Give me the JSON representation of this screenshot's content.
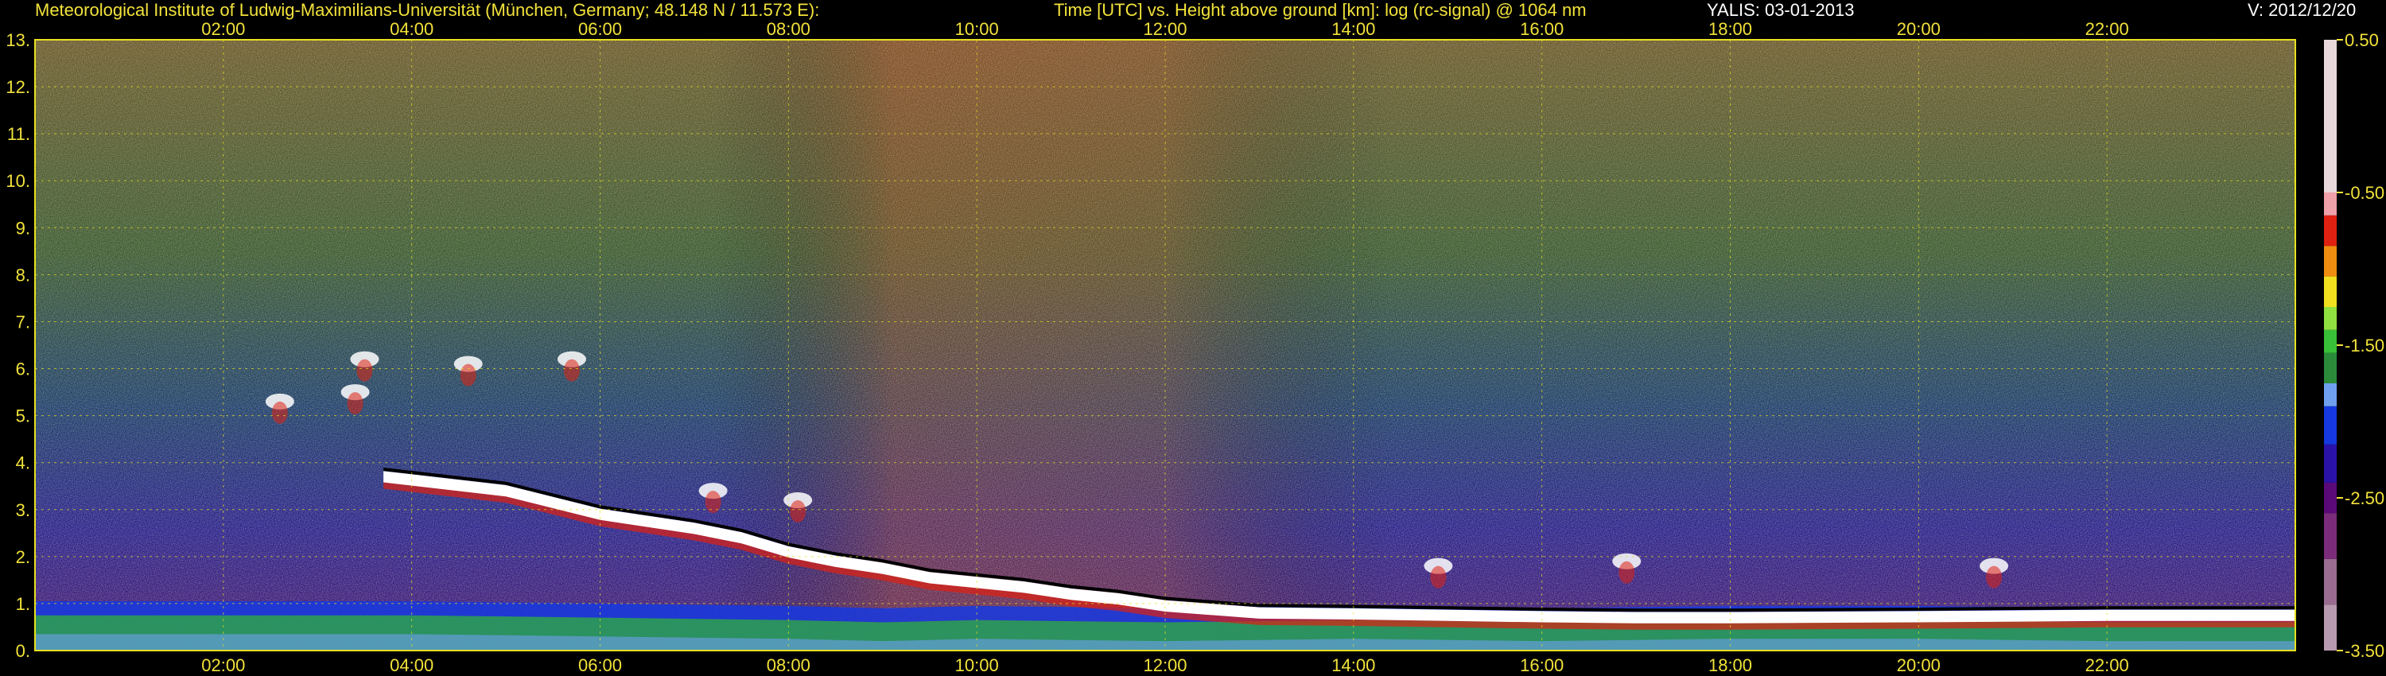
{
  "header": {
    "institute": "Meteorological Institute of Ludwig-Maximilians-Universität (München, Germany; 48.148 N / 11.573 E):",
    "description": "Time [UTC] vs. Height above ground [km]: log (rc-signal) @ 1064 nm",
    "instrument_date": "YALIS: 03-01-2013",
    "version": "V: 2012/12/20"
  },
  "colors": {
    "background": "#000000",
    "axis_text": "#f2e23a",
    "grid": "#e8e020",
    "signal_white": "#ffffff"
  },
  "chart_data": {
    "type": "heatmap",
    "x": {
      "unit": "UTC hours",
      "range": [
        0,
        24
      ],
      "tick_values": [
        2,
        4,
        6,
        8,
        10,
        12,
        14,
        16,
        18,
        20,
        22
      ],
      "tick_labels": [
        "02:00",
        "04:00",
        "06:00",
        "08:00",
        "10:00",
        "12:00",
        "14:00",
        "16:00",
        "18:00",
        "20:00",
        "22:00"
      ],
      "ticks_top": true,
      "ticks_bottom": true
    },
    "y": {
      "unit": "km",
      "range": [
        0,
        13
      ],
      "tick_values": [
        0,
        1,
        2,
        3,
        4,
        5,
        6,
        7,
        8,
        9,
        10,
        11,
        12,
        13
      ],
      "tick_labels": [
        "0.",
        "1.",
        "2.",
        "3.",
        "4.",
        "5.",
        "6.",
        "7.",
        "8.",
        "9.",
        "10.",
        "11.",
        "12.",
        "13."
      ]
    },
    "grid": true,
    "colorbar": {
      "position": "right",
      "range": [
        -3.5,
        0.5
      ],
      "tick_values": [
        0.5,
        -0.5,
        -1.5,
        -2.5,
        -3.5
      ],
      "tick_labels": [
        "0.50",
        "-0.50",
        "-1.50",
        "-2.50",
        "-3.50"
      ],
      "stops": [
        {
          "value": -3.5,
          "color": "#b89ab0"
        },
        {
          "value": -3.2,
          "color": "#9a6c92"
        },
        {
          "value": -2.9,
          "color": "#7a2c7a"
        },
        {
          "value": -2.6,
          "color": "#5a0a78"
        },
        {
          "value": -2.4,
          "color": "#2a12a8"
        },
        {
          "value": -2.15,
          "color": "#1638e0"
        },
        {
          "value": -1.9,
          "color": "#6fa0f0"
        },
        {
          "value": -1.75,
          "color": "#2a8a3a"
        },
        {
          "value": -1.55,
          "color": "#38c038"
        },
        {
          "value": -1.4,
          "color": "#90e040"
        },
        {
          "value": -1.25,
          "color": "#f0e020"
        },
        {
          "value": -1.05,
          "color": "#f08c10"
        },
        {
          "value": -0.85,
          "color": "#e02010"
        },
        {
          "value": -0.65,
          "color": "#f0a0a8"
        },
        {
          "value": -0.5,
          "color": "#e8d8dc"
        },
        {
          "value": 0.5,
          "color": "#ffffff"
        }
      ]
    },
    "features": {
      "boundary_layer_top_km": [
        [
          0,
          0.55
        ],
        [
          2,
          0.55
        ],
        [
          4,
          0.55
        ],
        [
          6,
          0.5
        ],
        [
          8,
          0.45
        ],
        [
          9,
          0.4
        ],
        [
          10,
          0.45
        ],
        [
          12,
          0.4
        ],
        [
          14,
          0.45
        ],
        [
          16,
          0.4
        ],
        [
          18,
          0.45
        ],
        [
          20,
          0.45
        ],
        [
          22,
          0.4
        ],
        [
          24,
          0.4
        ]
      ],
      "descending_cloud_layer_km": [
        [
          3.7,
          3.7
        ],
        [
          5.0,
          3.4
        ],
        [
          6.0,
          2.9
        ],
        [
          7.0,
          2.6
        ],
        [
          7.5,
          2.4
        ],
        [
          8.0,
          2.1
        ],
        [
          8.5,
          1.9
        ],
        [
          9.0,
          1.75
        ],
        [
          9.5,
          1.55
        ],
        [
          10.0,
          1.45
        ],
        [
          10.5,
          1.35
        ],
        [
          11.0,
          1.2
        ],
        [
          11.5,
          1.1
        ],
        [
          12.0,
          0.95
        ],
        [
          13.0,
          0.8
        ],
        [
          14.0,
          0.78
        ],
        [
          15.0,
          0.75
        ],
        [
          16.0,
          0.72
        ],
        [
          17.0,
          0.7
        ],
        [
          18.0,
          0.7
        ],
        [
          20.0,
          0.72
        ],
        [
          22.0,
          0.75
        ],
        [
          24.0,
          0.75
        ]
      ],
      "elevated_aerosol_patches": [
        {
          "time": 3.5,
          "height_km": 6.2
        },
        {
          "time": 3.4,
          "height_km": 5.5
        },
        {
          "time": 4.6,
          "height_km": 6.1
        },
        {
          "time": 5.7,
          "height_km": 6.2
        },
        {
          "time": 2.6,
          "height_km": 5.3
        },
        {
          "time": 7.2,
          "height_km": 3.4
        },
        {
          "time": 8.1,
          "height_km": 3.2
        },
        {
          "time": 14.9,
          "height_km": 1.8
        },
        {
          "time": 16.9,
          "height_km": 1.9
        },
        {
          "time": 20.8,
          "height_km": 1.8
        }
      ]
    }
  }
}
